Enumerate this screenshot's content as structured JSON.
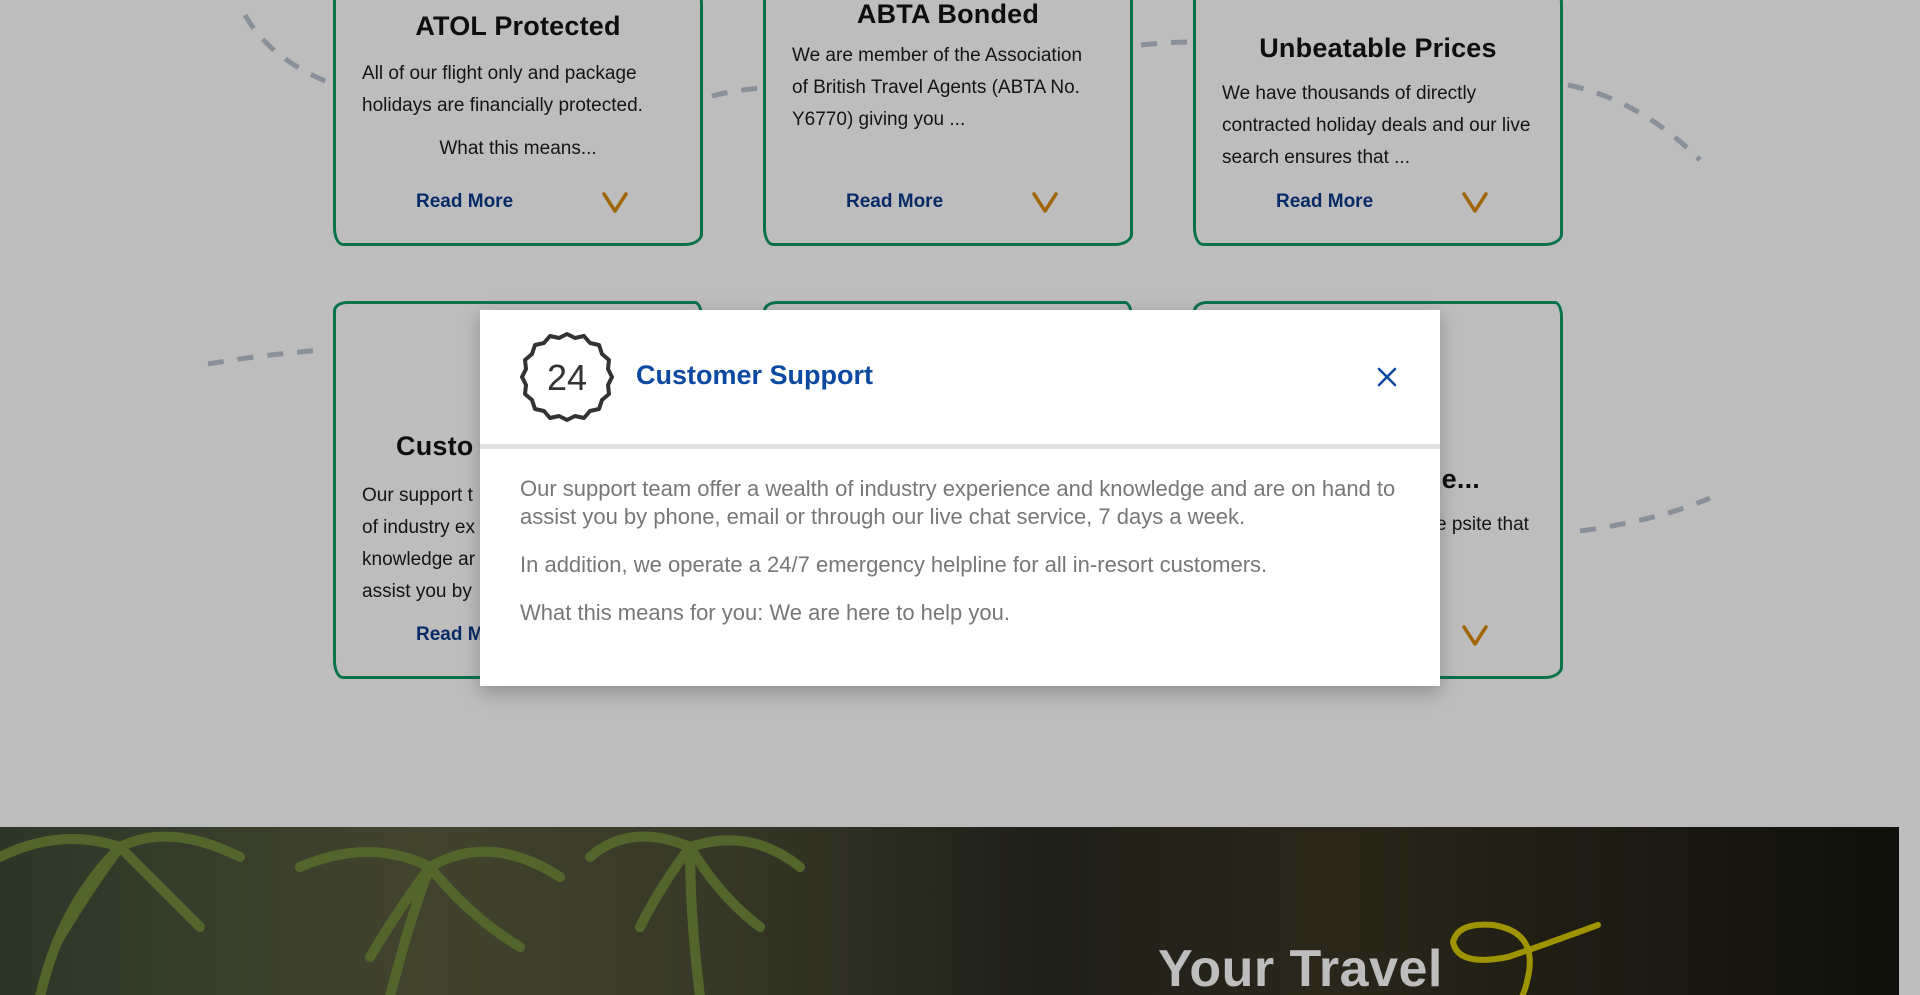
{
  "cards": [
    {
      "title": "ATOL Protected",
      "body": "All of our flight only and package holidays are financially protected.",
      "extra": "What this means...",
      "more": "Read More"
    },
    {
      "title": "ABTA Bonded",
      "body": "We are member of the Association of British Travel Agents (ABTA No. Y6770) giving you ...",
      "more": "Read More"
    },
    {
      "title": "Unbeatable Prices",
      "body": "We have thousands of directly contracted holiday deals and our live search ensures that ...",
      "more": "Read More"
    },
    {
      "title": "Custo",
      "body": "Our support t of industry ex knowledge ar assist you by",
      "more": "Read M"
    },
    {
      "title": "e...",
      "body": "e psite that",
      "more": ""
    }
  ],
  "modal": {
    "badge": "24",
    "title": "Customer Support",
    "close": "X",
    "paragraphs": [
      "Our support team offer a wealth of industry experience and knowledge and are on hand to assist you by phone, email or through our live chat service, 7 days a week.",
      "In addition, we operate a 24/7 emergency helpline for all in-resort customers.",
      "What this means for you: We are here to help you."
    ]
  },
  "hero": {
    "title": "Your Travel"
  },
  "colors": {
    "card_border": "#0b9a63",
    "read_more": "#0b3a8c",
    "chevron": "#d98a0b",
    "modal_title": "#0b4aa0",
    "accent_yellow": "#d4c800"
  },
  "icons": {
    "chevron": "chevron-down-icon",
    "close": "close-icon",
    "badge": "24-hours-icon"
  }
}
